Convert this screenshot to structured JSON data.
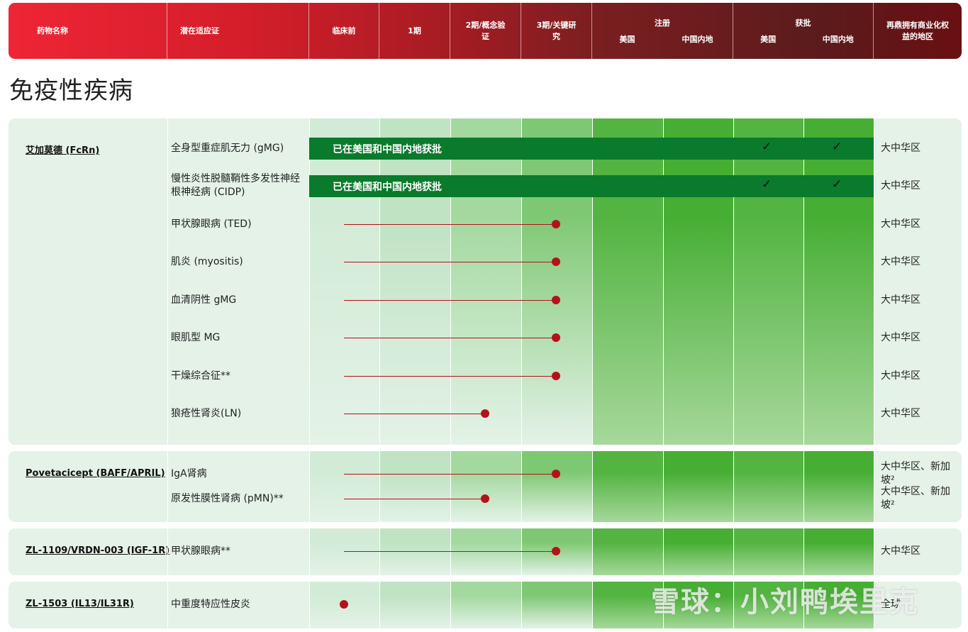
{
  "header": {
    "drug_name": "药物名称",
    "indication": "潜在适应证",
    "preclinical": "临床前",
    "phase1": "1期",
    "phase2": "2期/概念验证",
    "phase3": "3期/关键研究",
    "registration": {
      "label": "注册",
      "us": "美国",
      "cn": "中国内地"
    },
    "approval": {
      "label": "获批",
      "us": "美国",
      "cn": "中国内地"
    },
    "rights": "再鼎拥有商业化权益的地区"
  },
  "section_title": "免疫性疾病",
  "panels": [
    {
      "drug": "艾加莫德 (FcRn)",
      "rows": [
        {
          "indication": "全身型重症肌无力 (gMG)",
          "status": "approved",
          "bar_label": "已在美国和中国内地获批",
          "region": "大中华区"
        },
        {
          "indication": "慢性炎性脱髓鞘性多发性神经根神经病 (CIDP)",
          "status": "approved",
          "bar_label": "已在美国和中国内地获批",
          "region": "大中华区"
        },
        {
          "indication": "甲状腺眼病 (TED)",
          "status": "phase3",
          "region": "大中华区"
        },
        {
          "indication": "肌炎 (myositis)",
          "status": "phase3",
          "region": "大中华区"
        },
        {
          "indication": "血清阴性 gMG",
          "status": "phase3",
          "region": "大中华区"
        },
        {
          "indication": "眼肌型 MG",
          "status": "phase3",
          "region": "大中华区"
        },
        {
          "indication": "干燥综合征**",
          "status": "phase3",
          "region": "大中华区"
        },
        {
          "indication": "狼疮性肾炎(LN)",
          "status": "phase2",
          "region": "大中华区"
        }
      ]
    },
    {
      "drug": "Povetacicept (BAFF/APRIL)",
      "rows": [
        {
          "indication": "IgA肾病",
          "status": "phase3",
          "region": "大中华区、新加坡²"
        },
        {
          "indication": "原发性膜性肾病 (pMN)**",
          "status": "phase2",
          "region": "大中华区、新加坡²"
        }
      ]
    },
    {
      "drug": "ZL-1109/VRDN-003 (IGF-1R)",
      "rows": [
        {
          "indication": "甲状腺眼病**",
          "status": "phase3",
          "region": "大中华区"
        }
      ]
    },
    {
      "drug": "ZL-1503 (IL13/IL31R)",
      "rows": [
        {
          "indication": "中重度特应性皮炎",
          "status": "preclinical",
          "region": "全球"
        }
      ]
    }
  ],
  "check_mark": "✓",
  "watermark": "雪球：小刘鸭埃里克",
  "colors": {
    "header_start": "#ee2535",
    "header_end": "#6a0f12",
    "approved_bar": "#0a7a2c",
    "progress": "#b3121b",
    "panel_bg": "#e4f2e8"
  }
}
